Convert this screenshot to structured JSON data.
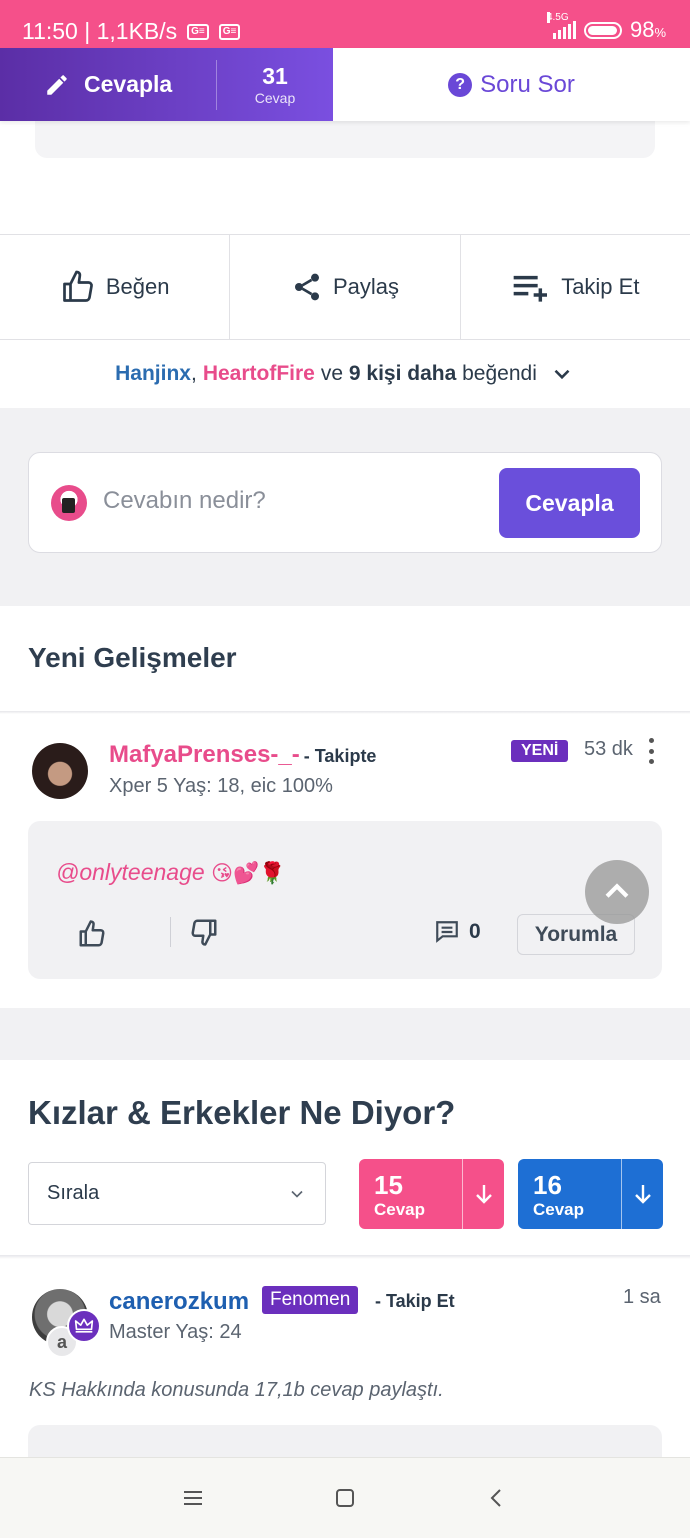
{
  "status_bar": {
    "time_speed": "11:50 | 1,1KB/s",
    "network": "4.5G",
    "battery": "98",
    "battery_unit": "%"
  },
  "top_bar": {
    "answer_label": "Cevapla",
    "answer_count": "31",
    "answer_count_label": "Cevap",
    "ask_label": "Soru Sor"
  },
  "actions": {
    "like_label": "Beğen",
    "share_label": "Paylaş",
    "follow_label": "Takip Et"
  },
  "likers": {
    "user1": "Hanjinx",
    "comma": ",",
    "user2": "HeartofFire",
    "rest_prefix": "ve",
    "rest_bold": "9 kişi daha",
    "rest_suffix": "beğendi"
  },
  "reply": {
    "placeholder": "Cevabın nedir?",
    "button": "Cevapla"
  },
  "updates": {
    "title": "Yeni Gelişmeler",
    "post": {
      "username": "MafyaPrenses-_-",
      "follow_status": "- Takipte",
      "meta": "Xper 5 Yaş: 18, eic 100%",
      "badge": "YENİ",
      "time": "53 dk",
      "text": "@onlyteenage",
      "emojis": "😘💕🌹",
      "comment_count": "0",
      "comment_button": "Yorumla"
    }
  },
  "opinions": {
    "title": "Kızlar & Erkekler Ne Diyor?",
    "sort_label": "Sırala",
    "girls": {
      "count": "15",
      "label": "Cevap",
      "color": "#f5508a"
    },
    "boys": {
      "count": "16",
      "label": "Cevap",
      "color": "#1e6fd4"
    }
  },
  "answer": {
    "username": "canerozkum",
    "badge": "Fenomen",
    "follow": "- Takip Et",
    "time": "1 sa",
    "meta": "Master Yaş: 24",
    "avatar_letter": "a",
    "note": "KS Hakkında konusunda 17,1b cevap paylaştı."
  },
  "colors": {
    "status_bar": "#f5508a",
    "accent_purple": "#6a4fdb",
    "girls_pink": "#e84c8b",
    "boys_blue": "#1e6fd4"
  },
  "icons": [
    "pencil-icon",
    "question-icon",
    "thumbs-up-icon",
    "share-icon",
    "playlist-add-icon",
    "chevron-down-icon",
    "thumb-up-outline-icon",
    "thumb-down-outline-icon",
    "comment-icon",
    "chevron-up-icon",
    "arrow-down-icon",
    "crown-icon",
    "menu-icon",
    "home-icon",
    "back-icon"
  ]
}
